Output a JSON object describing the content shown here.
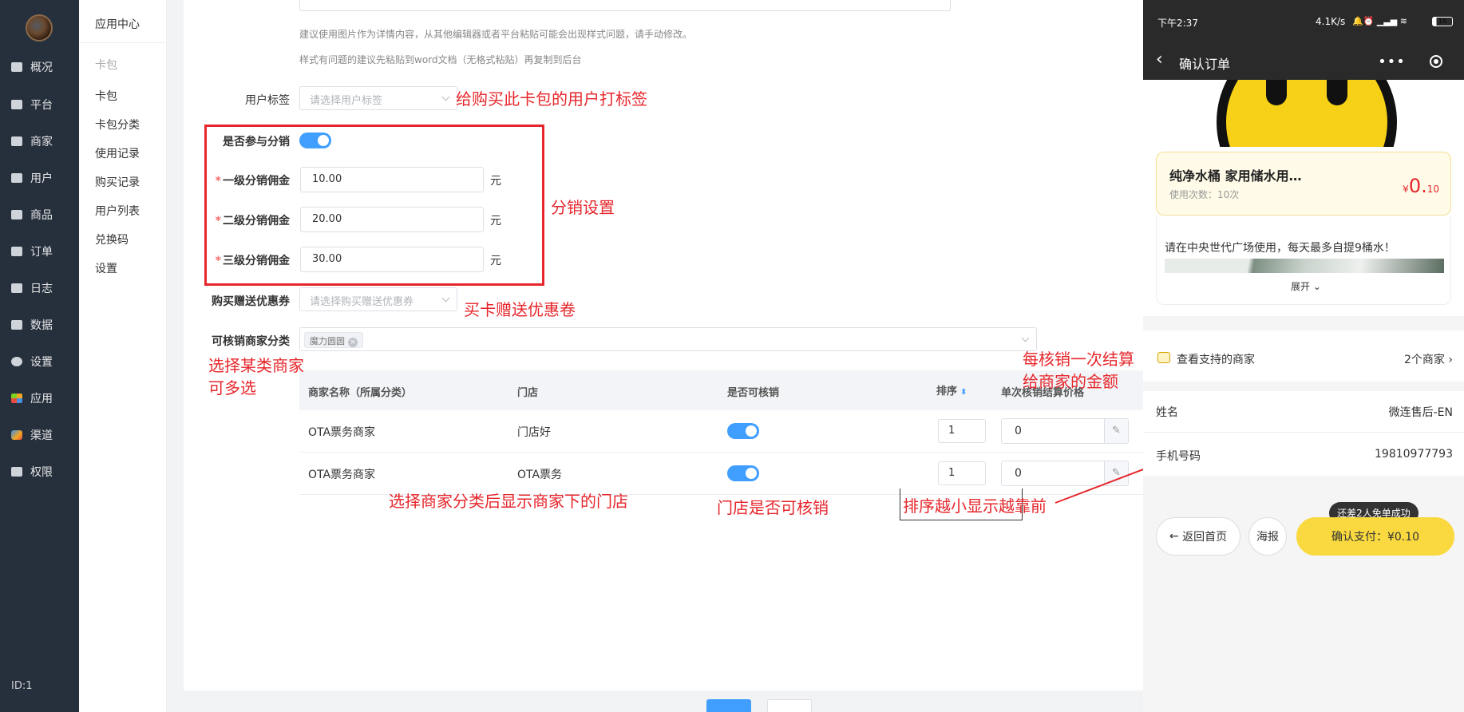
{
  "sidebar": {
    "items": [
      {
        "label": "概况",
        "icon": "dashboard-icon"
      },
      {
        "label": "平台",
        "icon": "monitor-icon"
      },
      {
        "label": "商家",
        "icon": "store-icon"
      },
      {
        "label": "用户",
        "icon": "user-icon"
      },
      {
        "label": "商品",
        "icon": "goods-icon"
      },
      {
        "label": "订单",
        "icon": "order-icon"
      },
      {
        "label": "日志",
        "icon": "log-icon"
      },
      {
        "label": "数据",
        "icon": "chart-icon"
      },
      {
        "label": "设置",
        "icon": "gear-icon"
      },
      {
        "label": "应用",
        "icon": "apps-icon"
      },
      {
        "label": "渠道",
        "icon": "cube-icon"
      },
      {
        "label": "权限",
        "icon": "lock-icon"
      }
    ],
    "id_text": "ID:1"
  },
  "subnav": {
    "title": "应用中心",
    "group_label": "卡包",
    "items": [
      "卡包",
      "卡包分类",
      "使用记录",
      "购买记录",
      "用户列表",
      "兑换码",
      "设置"
    ]
  },
  "form": {
    "hint1": "建议使用图片作为详情内容，从其他编辑器或者平台粘贴可能会出现样式问题，请手动修改。",
    "hint2": "样式有问题的建议先粘贴到word文档（无格式粘贴）再复制到后台",
    "user_tag_label": "用户标签",
    "user_tag_placeholder": "请选择用户标签",
    "distribution_label": "是否参与分销",
    "level1_label": "一级分销佣金",
    "level1_value": "10.00",
    "level2_label": "二级分销佣金",
    "level2_value": "20.00",
    "level3_label": "三级分销佣金",
    "level3_value": "30.00",
    "unit": "元",
    "required_mark": "*",
    "coupon_label": "购买赠送优惠券",
    "coupon_placeholder": "请选择购买赠送优惠券",
    "merchant_cat_label": "可核销商家分类",
    "merchant_cat_tag": "魔力圆圆",
    "table": {
      "headers": [
        "商家名称（所属分类）",
        "门店",
        "是否可核销",
        "排序",
        "单次核销结算价格"
      ],
      "rows": [
        {
          "merchant": "OTA票务商家",
          "store": "门店好",
          "enabled": true,
          "sort": "1",
          "price": "0"
        },
        {
          "merchant": "OTA票务商家",
          "store": "OTA票务",
          "enabled": true,
          "sort": "1",
          "price": "0"
        }
      ]
    }
  },
  "annotations": {
    "user_tag": "给购买此卡包的用户打标签",
    "distribution": "分销设置",
    "coupon": "买卡赠送优惠卷",
    "merchant_cat_1": "选择某类商家",
    "merchant_cat_2": "可多选",
    "settle_1": "每核销一次结算",
    "settle_2": "给商家的金额",
    "stores": "选择商家分类后显示商家下的门店",
    "store_enabled": "门店是否可核销",
    "sort": "排序越小显示越靠前"
  },
  "phone": {
    "status_time": "下午2:37",
    "status_right": "4.1K/s",
    "battery": "18",
    "nav_title": "确认订单",
    "product_name": "纯净水桶 家用储水用…",
    "usage": "使用次数：10次",
    "price_symbol": "¥",
    "price_int": "0.",
    "price_dec": "10",
    "desc": "请在中央世代广场使用，每天最多自提9桶水！",
    "expand": "展开",
    "merchants_label": "查看支持的商家",
    "merchants_value": "2个商家",
    "name_label": "姓名",
    "name_value": "微连售后-EN",
    "phone_label": "手机号码",
    "phone_value": "19810977793",
    "tooltip": "还差2人免单成功",
    "back_btn": "返回首页",
    "poster_btn": "海报",
    "pay_btn": "确认支付：¥0.10"
  },
  "colors": {
    "sidebar_bg": "#26303d",
    "accent": "#409eff",
    "annotation": "#e6262b",
    "pay_button": "#f9d93f"
  }
}
